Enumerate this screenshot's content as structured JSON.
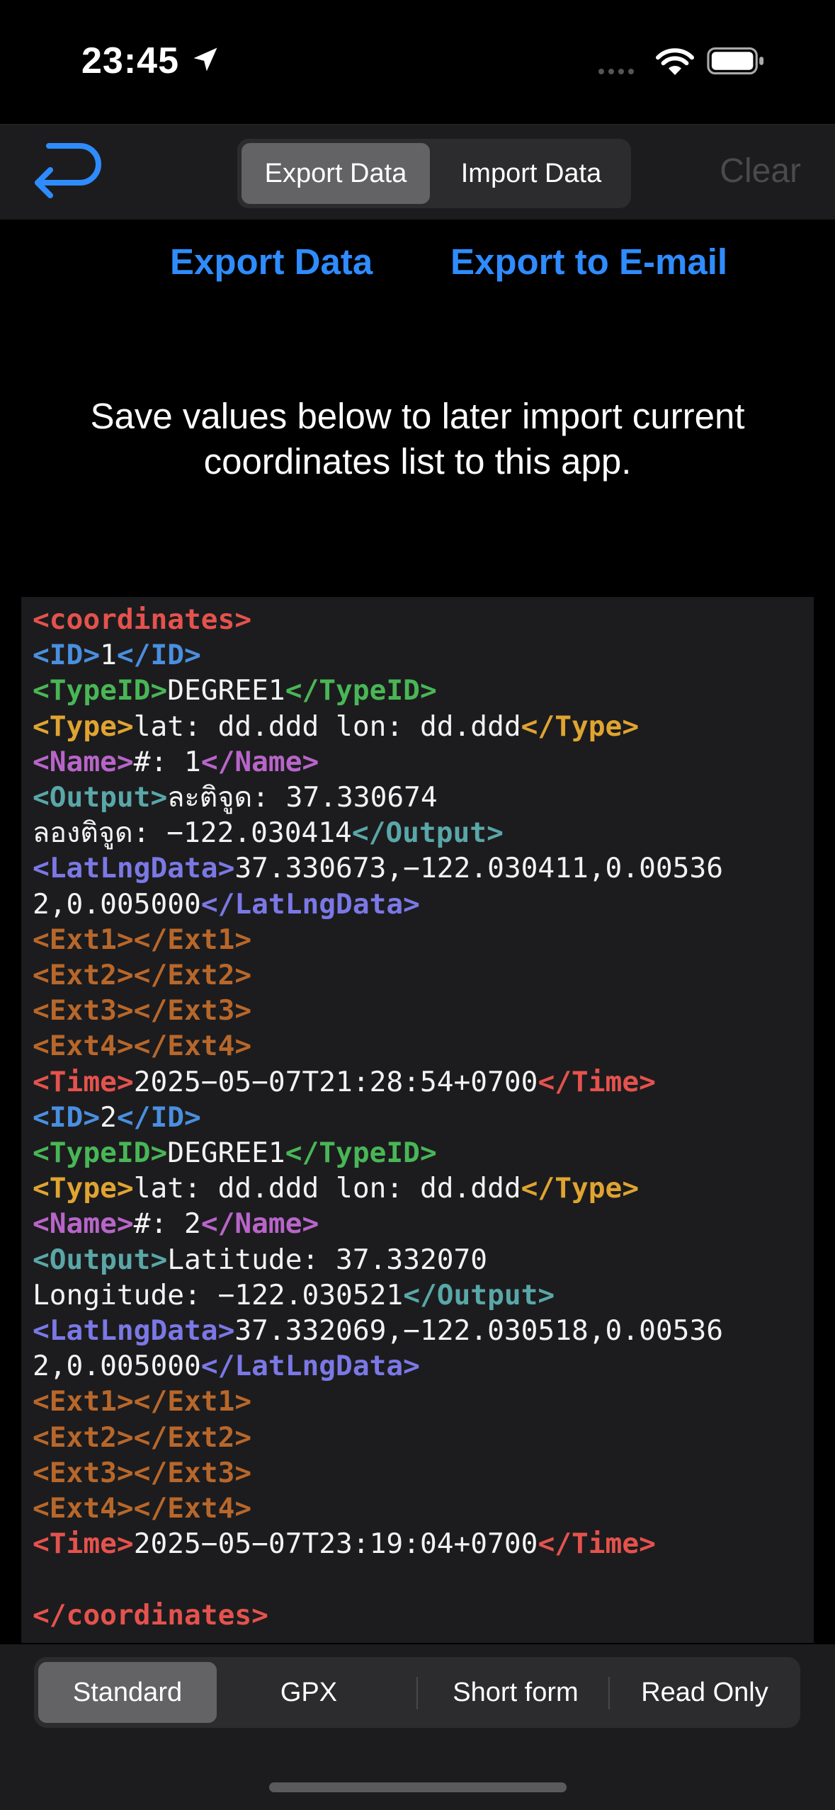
{
  "status_bar": {
    "time": "23:45"
  },
  "toolbar": {
    "tabs": [
      {
        "label": "Export Data",
        "selected": true
      },
      {
        "label": "Import Data",
        "selected": false
      }
    ],
    "clear_label": "Clear"
  },
  "actions": {
    "export_data_label": "Export Data",
    "export_email_label": "Export to E-mail"
  },
  "note": {
    "line1": "Save values below to later import current",
    "line2": "coordinates list to this app."
  },
  "code": {
    "root_open": "<coordinates>",
    "records": [
      {
        "id": "1",
        "type_id": "DEGREE1",
        "type": "lat: dd.ddd lon: dd.ddd",
        "name": "#: 1",
        "output_line1": "ละติจูด: 37.330674",
        "output_line2": "ลองติจูด: −122.030414",
        "latlng_line1": "37.330673,−122.030411,0.00536",
        "latlng_line2": "2,0.005000",
        "time": "2025−05−07T21:28:54+0700"
      },
      {
        "id": "2",
        "type_id": "DEGREE1",
        "type": "lat: dd.ddd lon: dd.ddd",
        "name": "#: 2",
        "output_line1": "Latitude: 37.332070",
        "output_line2": "Longitude: −122.030521",
        "latlng_line1": "37.332069,−122.030518,0.00536",
        "latlng_line2": "2,0.005000",
        "time": "2025−05−07T23:19:04+0700"
      }
    ],
    "root_close": "</coordinates>",
    "colors": {
      "root": "#e5524d",
      "id": "#4a8fe0",
      "type_id": "#49b656",
      "type": "#e0a431",
      "name": "#b865c9",
      "output": "#5aa7a8",
      "latlng": "#7b78e6",
      "ext": "#b8672a",
      "time": "#e5524d"
    }
  },
  "bottom_tabs": [
    {
      "label": "Standard",
      "selected": true
    },
    {
      "label": "GPX",
      "selected": false
    },
    {
      "label": "Short form",
      "selected": false
    },
    {
      "label": "Read Only",
      "selected": false
    }
  ],
  "accent_color": "#2f8cff"
}
